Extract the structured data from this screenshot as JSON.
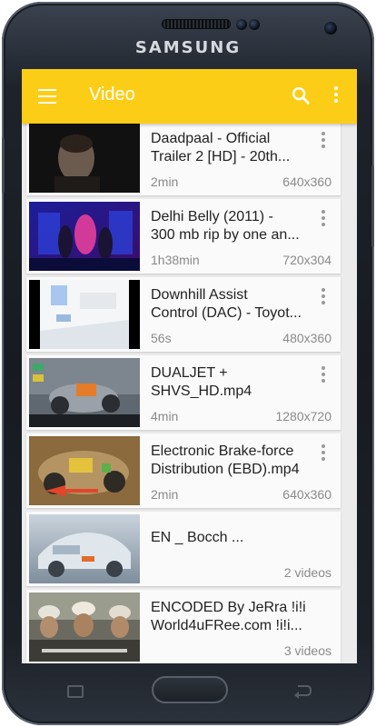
{
  "device": {
    "brand": "SAMSUNG"
  },
  "appbar": {
    "title": "Video",
    "icons": [
      "menu-icon",
      "search-icon",
      "more-vert-icon"
    ],
    "color": "#fccd16"
  },
  "items": [
    {
      "title_line1": "Daadpaal - Official",
      "title_line2": "Trailer 2 [HD] - 20th...",
      "duration": "2min",
      "resolution": "640x360"
    },
    {
      "title_line1": "Delhi Belly (2011) -",
      "title_line2": "300 mb rip by one an...",
      "duration": "1h38min",
      "resolution": "720x304"
    },
    {
      "title_line1": "Downhill Assist",
      "title_line2": "Control (DAC) - Toyot...",
      "duration": "56s",
      "resolution": "480x360"
    },
    {
      "title_line1": "DUALJET +",
      "title_line2": "SHVS_HD.mp4",
      "duration": "4min",
      "resolution": "1280x720"
    },
    {
      "title_line1": "Electronic Brake-force",
      "title_line2": "Distribution (EBD).mp4",
      "duration": "2min",
      "resolution": "640x360"
    },
    {
      "title_line1": "EN _ Bocch ...",
      "title_line2": "",
      "duration": "",
      "resolution": "2 videos"
    },
    {
      "title_line1": "ENCODED By JeRra !i!i",
      "title_line2": "World4uFRee.com !i!i...",
      "duration": "",
      "resolution": "3 videos"
    }
  ]
}
